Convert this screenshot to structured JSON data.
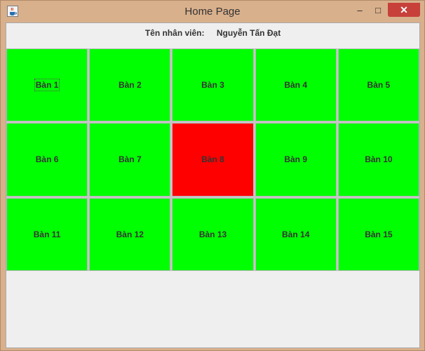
{
  "window": {
    "title": "Home Page",
    "controls": {
      "minimize": "–",
      "maximize": "□",
      "close": "✕"
    }
  },
  "employee": {
    "label": "Tên nhân viên:",
    "name": "Nguyễn Tấn Đạt"
  },
  "tables": [
    {
      "label": "Bàn 1",
      "status": "free",
      "focused": true
    },
    {
      "label": "Bàn 2",
      "status": "free"
    },
    {
      "label": "Bàn 3",
      "status": "free"
    },
    {
      "label": "Bàn 4",
      "status": "free"
    },
    {
      "label": "Bàn 5",
      "status": "free"
    },
    {
      "label": "Bàn 6",
      "status": "free"
    },
    {
      "label": "Bàn 7",
      "status": "free"
    },
    {
      "label": "Bàn 8",
      "status": "busy"
    },
    {
      "label": "Bàn 9",
      "status": "free"
    },
    {
      "label": "Bàn 10",
      "status": "free"
    },
    {
      "label": "Bàn 11",
      "status": "free"
    },
    {
      "label": "Bàn 12",
      "status": "free"
    },
    {
      "label": "Bàn 13",
      "status": "free"
    },
    {
      "label": "Bàn 14",
      "status": "free"
    },
    {
      "label": "Bàn 15",
      "status": "free"
    }
  ],
  "colors": {
    "free": "#00ff00",
    "busy": "#ff0000",
    "titlebar": "#d9b08c",
    "close_button": "#c7403a"
  },
  "icons": {
    "app": "java-cup-icon"
  }
}
